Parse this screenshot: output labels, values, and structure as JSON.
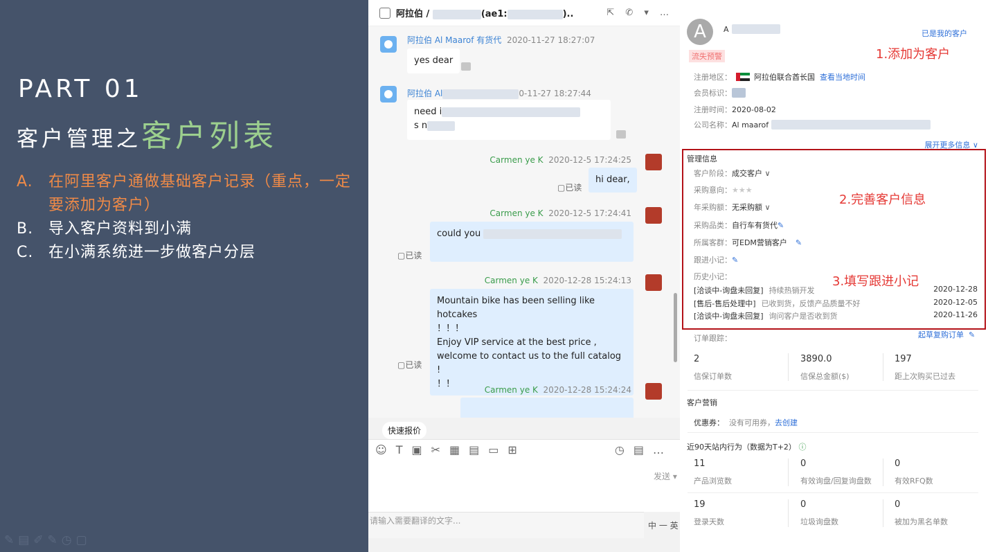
{
  "slide": {
    "part": "PART 01",
    "title_prefix": "客户管理之",
    "title_highlight": "客户列表",
    "points": [
      {
        "key": "A.",
        "text": "在阿里客户通做基础客户记录（重点，一定要添加为客户）"
      },
      {
        "key": "B.",
        "text": "导入客户资料到小满"
      },
      {
        "key": "C.",
        "text": "在小满系统进一步做客户分层"
      }
    ]
  },
  "chat": {
    "title": "阿拉伯 /",
    "title_mid": "(ae1:",
    "title_end": ")..",
    "msgs": {
      "m1": {
        "name": "阿拉伯 Al Maarof 有货代",
        "time": "2020-11-27 18:27:07",
        "text": "yes dear"
      },
      "m2": {
        "name": "阿拉伯 Al",
        "time": "0-11-27 18:27:44",
        "line1": "need i",
        "line2": "s n"
      },
      "m3": {
        "name": "Carmen ye K",
        "time": "2020-12-5 17:24:25",
        "text": "hi dear,",
        "read": "已读"
      },
      "m4": {
        "name": "Carmen ye K",
        "time": "2020-12-5 17:24:41",
        "text": "could you",
        "read": "已读"
      },
      "m5": {
        "name": "Carmen ye K",
        "time": "2020-12-28 15:24:13",
        "l1": "Mountain bike has been selling like hotcakes",
        "l2": "！！！",
        "l3": "Enjoy VIP service at the best price ,",
        "l4": "welcome to contact us to the full catalog !",
        "l5": "！！",
        "read": "已读"
      },
      "m6": {
        "name": "Carmen ye K",
        "time": "2020-12-28 15:24:24"
      }
    },
    "quick_quote": "快速报价",
    "send": "发送",
    "translate_placeholder": "请输入需要翻译的文字...",
    "lang": "中 一 英"
  },
  "customer": {
    "avatar_letter": "A",
    "name": "A",
    "owner": "已是我的客户",
    "tag": "流失预警",
    "region_label": "注册地区：",
    "region": "阿拉伯联合酋长国",
    "local_time": "查看当地时间",
    "member_label": "会员标识：",
    "reg_time_label": "注册时间：",
    "reg_time": "2020-08-02",
    "company_label": "公司名称：",
    "company": "Al maarof",
    "expand": "展开更多信息",
    "mgmt_title": "管理信息",
    "stage_label": "客户阶段：",
    "stage": "成交客户",
    "intent_label": "采购意向：",
    "stars": "★★★",
    "annual_label": "年采购额：",
    "annual": "无采购额",
    "category_label": "采购品类：",
    "category": "自行车有货代",
    "group_label": "所属客群：",
    "group": "可EDM营销客户",
    "note_label": "跟进小记：",
    "history_label": "历史小记：",
    "history": [
      {
        "tag": "[洽谈中-询盘未回复]",
        "desc": "持续热销开发",
        "date": "2020-12-28"
      },
      {
        "tag": "[售后-售后处理中]",
        "desc": "已收到货，反馈产品质量不好",
        "date": "2020-12-05"
      },
      {
        "tag": "[洽谈中-询盘未回复]",
        "desc": "询问客户是否收到货",
        "date": "2020-11-26"
      }
    ],
    "order_label": "订单跟踪：",
    "reorder": "起草复购订单",
    "orders": [
      {
        "value": "2",
        "label": "信保订单数"
      },
      {
        "value": "3890.0",
        "label": "信保总金额($)"
      },
      {
        "value": "197",
        "label": "距上次购买已过去"
      }
    ],
    "marketing_label": "客户营销",
    "coupon_label": "优惠券：",
    "coupon_none": "没有可用券，",
    "coupon_create": "去创建",
    "behavior_label": "近90天站内行为（数据为T+2）",
    "behavior": [
      {
        "value": "11",
        "label": "产品浏览数"
      },
      {
        "value": "0",
        "label": "有效询盘/回复询盘数"
      },
      {
        "value": "0",
        "label": "有效RFQ数"
      },
      {
        "value": "19",
        "label": "登录天数"
      },
      {
        "value": "0",
        "label": "垃圾询盘数"
      },
      {
        "value": "0",
        "label": "被加为黑名单数"
      }
    ]
  },
  "annotations": {
    "a1": "1.添加为客户",
    "a2": "2.完善客户信息",
    "a3": "3.填写跟进小记"
  },
  "colors": {
    "slide_bg": "#45536a",
    "highlight_green": "#9ccf8e",
    "point_orange": "#ef8a47",
    "annotation_red": "#e53935",
    "frame_red": "#b31218",
    "link_blue": "#2e6fd8"
  }
}
